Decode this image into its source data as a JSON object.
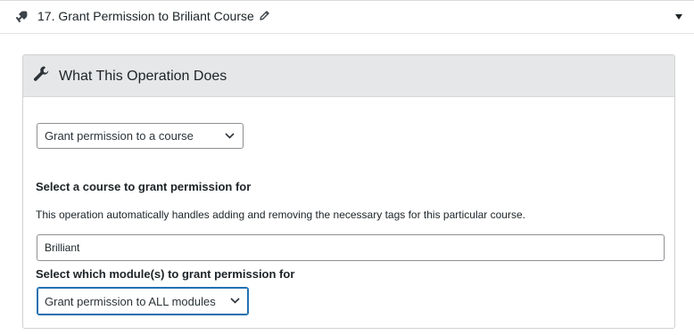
{
  "operation": {
    "title": "17. Grant Permission to Briliant Course",
    "icon": "rocket-strike-icon",
    "edit_icon": "pencil-icon",
    "toggle_icon": "caret-down-icon"
  },
  "box": {
    "title": "What This Operation Does",
    "icon": "wrench-icon"
  },
  "operation_select": {
    "selected": "Grant permission to a course"
  },
  "course": {
    "label": "Select a course to grant permission for",
    "description": "This operation automatically handles adding and removing the necessary tags for this particular course.",
    "value": "Brilliant"
  },
  "module": {
    "label": "Select which module(s) to grant permission for",
    "selected": "Grant permission to ALL modules"
  },
  "colors": {
    "focus_border": "#2271b1",
    "header_bg": "#e6e7e8"
  }
}
